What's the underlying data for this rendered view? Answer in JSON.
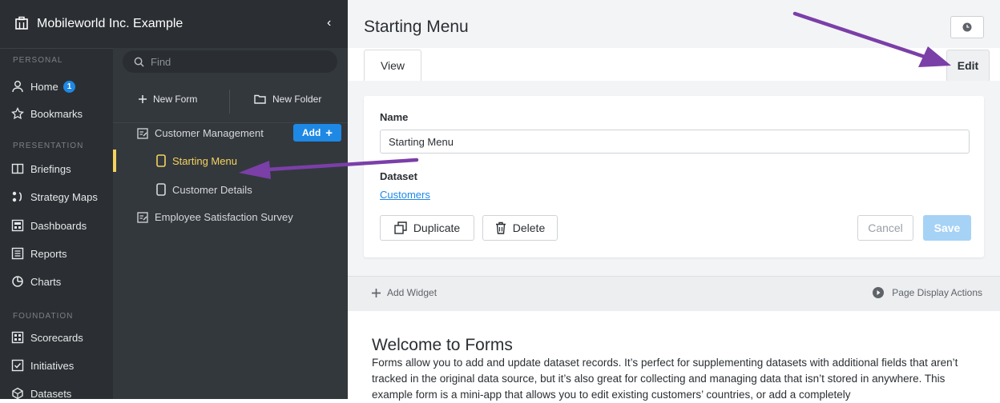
{
  "app": {
    "org_name": "Mobileworld Inc. Example"
  },
  "nav": {
    "sections": {
      "personal": "PERSONAL",
      "presentation": "PRESENTATION",
      "foundation": "FOUNDATION"
    },
    "home": {
      "label": "Home",
      "badge": "1"
    },
    "bookmarks": "Bookmarks",
    "briefings": "Briefings",
    "strategy_maps": "Strategy Maps",
    "dashboards": "Dashboards",
    "reports": "Reports",
    "charts": "Charts",
    "scorecards": "Scorecards",
    "initiatives": "Initiatives",
    "datasets": "Datasets"
  },
  "tree": {
    "search_placeholder": "Find",
    "new_form": "New Form",
    "new_folder": "New Folder",
    "add_button": "Add",
    "items": [
      "Customer Management",
      "Starting Menu",
      "Customer Details",
      "Employee Satisfaction Survey"
    ],
    "accent_color": "#f4d35e"
  },
  "main": {
    "title": "Starting Menu",
    "tabs": {
      "view": "View",
      "edit": "Edit"
    },
    "form": {
      "name_label": "Name",
      "name_value": "Starting Menu",
      "dataset_label": "Dataset",
      "dataset_link": "Customers",
      "duplicate": "Duplicate",
      "delete": "Delete",
      "cancel": "Cancel",
      "save": "Save"
    },
    "widget_bar": {
      "add_widget": "Add Widget",
      "page_display_actions": "Page Display Actions"
    },
    "welcome": {
      "title": "Welcome to Forms",
      "body": "Forms allow you to add and update dataset records. It’s perfect for supplementing datasets with additional fields that aren’t tracked in the original data source, but it’s also great for collecting and managing data that isn’t stored in anywhere. This example form is a mini-app that allows you to edit existing customers’ countries, or add a completely"
    }
  },
  "colors": {
    "brand_blue": "#1e88e5",
    "annotation_arrow": "#7b3fa8"
  }
}
